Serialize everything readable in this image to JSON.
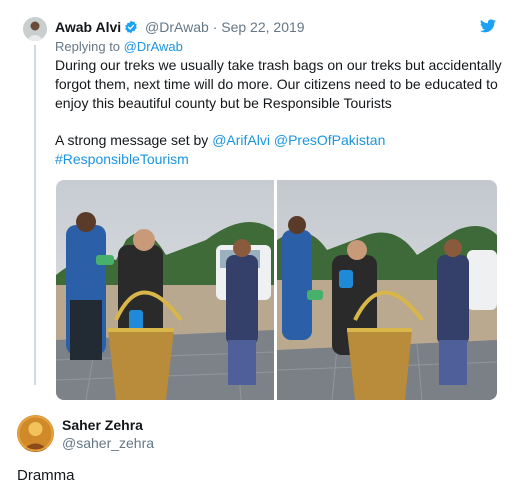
{
  "tweet1": {
    "name": "Awab Alvi",
    "handle": "@DrAwab",
    "separator": "·",
    "date": "Sep 22, 2019",
    "replying_prefix": "Replying to ",
    "replying_handle": "@DrAwab",
    "paragraph1": "During our treks we usually take trash bags on our treks but accidentally forgot them, next time will do more. Our citizens need to be educated to enjoy this beautiful county but be Responsible Tourists",
    "paragraph2_prefix": "A strong message set by ",
    "mention1": "@ArifAlvi",
    "mention2": "@PresOfPakistan",
    "hashtag": "#ResponsibleTourism",
    "photo_count": 2
  },
  "tweet2": {
    "name": "Saher Zehra",
    "handle": "@saher_zehra",
    "text": "Dramma"
  },
  "colors": {
    "link": "#1b95e0",
    "verified": "#1da1f2",
    "muted": "#657786",
    "text": "#14171a",
    "thread_line": "#cfd9de"
  },
  "icons": {
    "verified": "verified-badge-icon",
    "brand": "twitter-bird-icon"
  }
}
